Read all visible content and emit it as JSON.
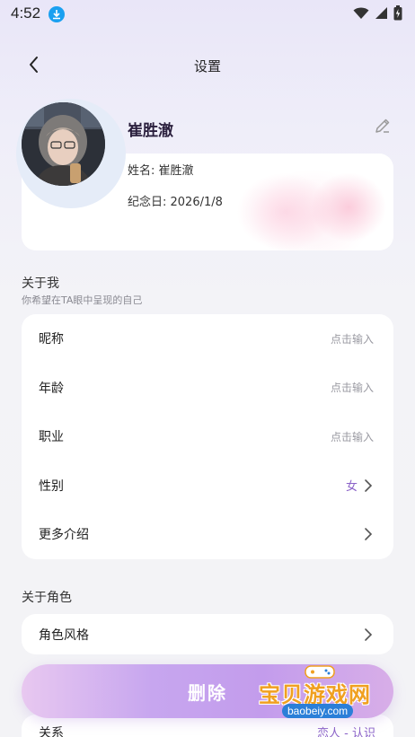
{
  "status_bar": {
    "time": "4:52"
  },
  "nav": {
    "title": "设置"
  },
  "profile": {
    "name": "崔胜澈",
    "name_line": "姓名: 崔胜澈",
    "anniversary_line": "纪念日: 2026/1/8"
  },
  "about_me": {
    "title": "关于我",
    "subtitle": "你希望在TA眼中呈现的自己",
    "rows": [
      {
        "label": "昵称",
        "placeholder": "点击输入"
      },
      {
        "label": "年龄",
        "placeholder": "点击输入"
      },
      {
        "label": "职业",
        "placeholder": "点击输入"
      },
      {
        "label": "性别",
        "value": "女"
      },
      {
        "label": "更多介绍"
      }
    ]
  },
  "about_role": {
    "title": "关于角色",
    "rows": [
      {
        "label": "角色风格"
      },
      {
        "label": "关系",
        "value": "恋人 - 认识"
      }
    ]
  },
  "delete_button": {
    "label": "删除"
  },
  "watermark": {
    "text": "宝贝游戏网",
    "url": "baobeiy.com"
  },
  "colors": {
    "accent": "#8b63c8",
    "download_badge": "#1aa0f0",
    "watermark": "#f0a020"
  }
}
